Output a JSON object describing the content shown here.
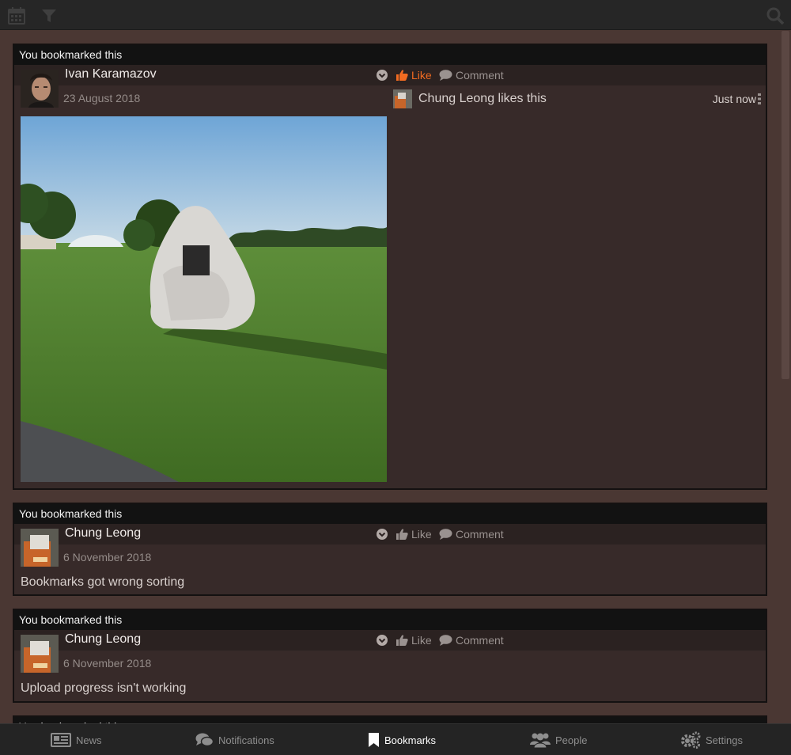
{
  "topbar": {
    "icons": [
      "calendar-icon",
      "filter-icon",
      "search-icon"
    ]
  },
  "stories": [
    {
      "header": "You bookmarked this",
      "author": "Ivan Karamazov",
      "date": "23 August 2018",
      "like_label": "Like",
      "liked": true,
      "comment_label": "Comment",
      "reaction": {
        "text": "Chung Leong likes this",
        "time": "Just now"
      }
    },
    {
      "header": "You bookmarked this",
      "author": "Chung Leong",
      "date": "6 November 2018",
      "like_label": "Like",
      "liked": false,
      "comment_label": "Comment",
      "text": "Bookmarks got wrong sorting"
    },
    {
      "header": "You bookmarked this",
      "author": "Chung Leong",
      "date": "6 November 2018",
      "like_label": "Like",
      "liked": false,
      "comment_label": "Comment",
      "text": "Upload progress isn't working"
    },
    {
      "header": "You bookmarked this"
    }
  ],
  "nav": {
    "news": "News",
    "notifications": "Notifications",
    "bookmarks": "Bookmarks",
    "people": "People",
    "settings": "Settings",
    "active": "bookmarks"
  },
  "colors": {
    "accent": "#f26b21",
    "background": "#4a3733",
    "card": "#372a29",
    "header": "#121212"
  }
}
